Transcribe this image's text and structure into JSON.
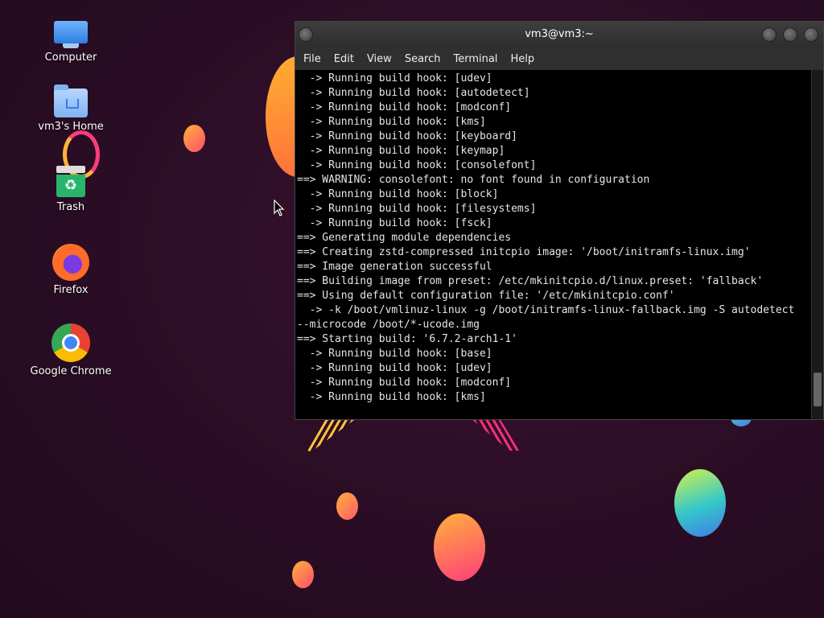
{
  "desktop": {
    "icons": [
      {
        "label": "Computer",
        "icon": "computer-icon"
      },
      {
        "label": "vm3's Home",
        "icon": "home-folder-icon"
      },
      {
        "label": "Trash",
        "icon": "trash-icon"
      },
      {
        "label": "Firefox",
        "icon": "firefox-icon"
      },
      {
        "label": "Google Chrome",
        "icon": "chrome-icon"
      }
    ]
  },
  "terminal": {
    "title": "vm3@vm3:~",
    "menu": [
      "File",
      "Edit",
      "View",
      "Search",
      "Terminal",
      "Help"
    ],
    "lines": [
      "  -> Running build hook: [udev]",
      "  -> Running build hook: [autodetect]",
      "  -> Running build hook: [modconf]",
      "  -> Running build hook: [kms]",
      "  -> Running build hook: [keyboard]",
      "  -> Running build hook: [keymap]",
      "  -> Running build hook: [consolefont]",
      "==> WARNING: consolefont: no font found in configuration",
      "  -> Running build hook: [block]",
      "  -> Running build hook: [filesystems]",
      "  -> Running build hook: [fsck]",
      "==> Generating module dependencies",
      "==> Creating zstd-compressed initcpio image: '/boot/initramfs-linux.img'",
      "==> Image generation successful",
      "==> Building image from preset: /etc/mkinitcpio.d/linux.preset: 'fallback'",
      "==> Using default configuration file: '/etc/mkinitcpio.conf'",
      "  -> -k /boot/vmlinuz-linux -g /boot/initramfs-linux-fallback.img -S autodetect",
      "--microcode /boot/*-ucode.img",
      "==> Starting build: '6.7.2-arch1-1'",
      "  -> Running build hook: [base]",
      "  -> Running build hook: [udev]",
      "  -> Running build hook: [modconf]",
      "  -> Running build hook: [kms]"
    ]
  }
}
